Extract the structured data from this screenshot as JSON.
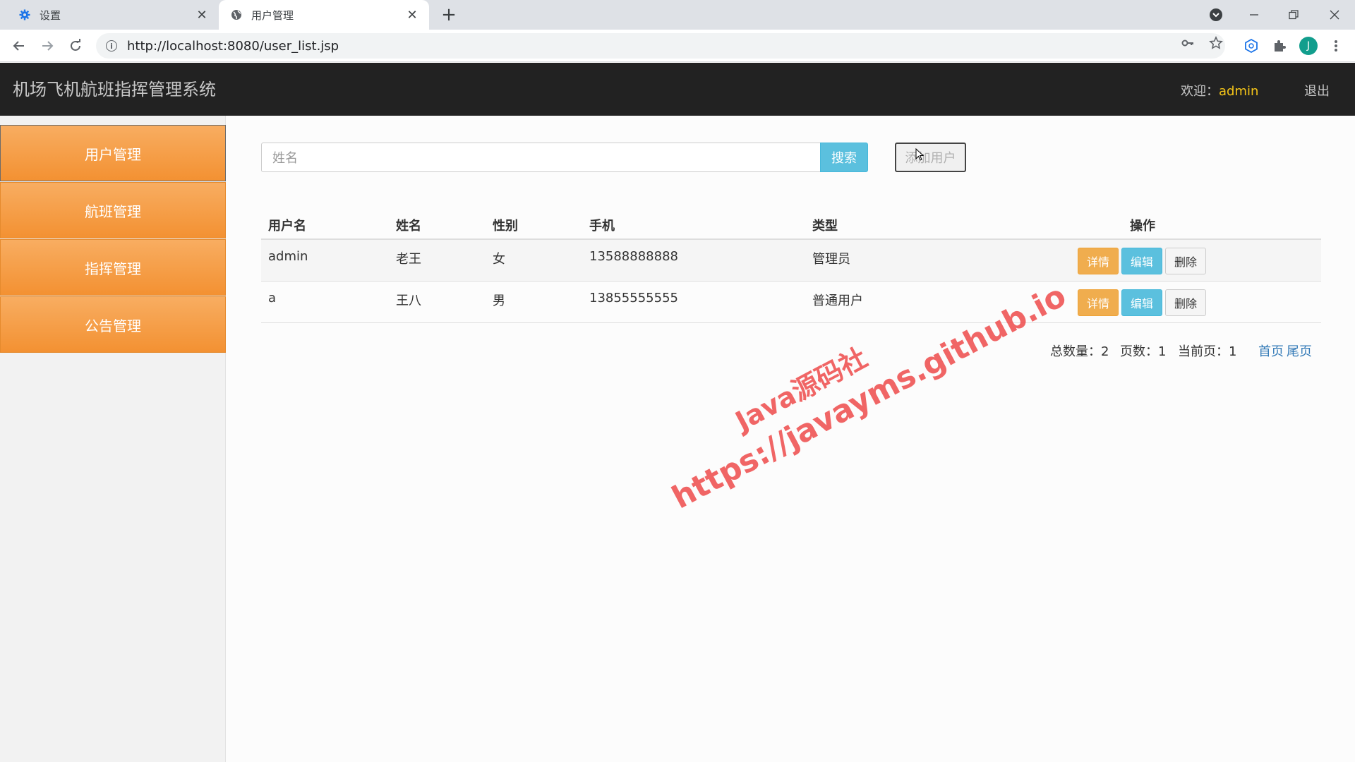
{
  "browser": {
    "tabs": [
      {
        "title": "设置",
        "icon": "gear-icon"
      },
      {
        "title": "用户管理",
        "icon": "globe-icon"
      }
    ],
    "url": "http://localhost:8080/user_list.jsp",
    "profile_initial": "J"
  },
  "app": {
    "title": "机场飞机航班指挥管理系统",
    "welcome_label": "欢迎：",
    "username": "admin",
    "logout": "退出"
  },
  "sidebar": {
    "items": [
      {
        "label": "用户管理",
        "active": true
      },
      {
        "label": "航班管理"
      },
      {
        "label": "指挥管理"
      },
      {
        "label": "公告管理"
      }
    ]
  },
  "search": {
    "placeholder": "姓名",
    "button": "搜索",
    "add_button": "添加用户"
  },
  "table": {
    "headers": [
      "用户名",
      "姓名",
      "性别",
      "手机",
      "类型",
      "操作"
    ],
    "rows": [
      {
        "username": "admin",
        "name": "老王",
        "gender": "女",
        "phone": "13588888888",
        "type": "管理员"
      },
      {
        "username": "a",
        "name": "王八",
        "gender": "男",
        "phone": "13855555555",
        "type": "普通用户"
      }
    ],
    "actions": {
      "detail": "详情",
      "edit": "编辑",
      "delete": "删除"
    }
  },
  "pagination": {
    "total_label": "总数量：",
    "total": "2",
    "pages_label": "页数：",
    "pages": "1",
    "current_label": "当前页：",
    "current": "1",
    "first": "首页",
    "last": "尾页"
  },
  "watermark": {
    "line1": "Java源码社",
    "line2": "https://javayms.github.io"
  }
}
